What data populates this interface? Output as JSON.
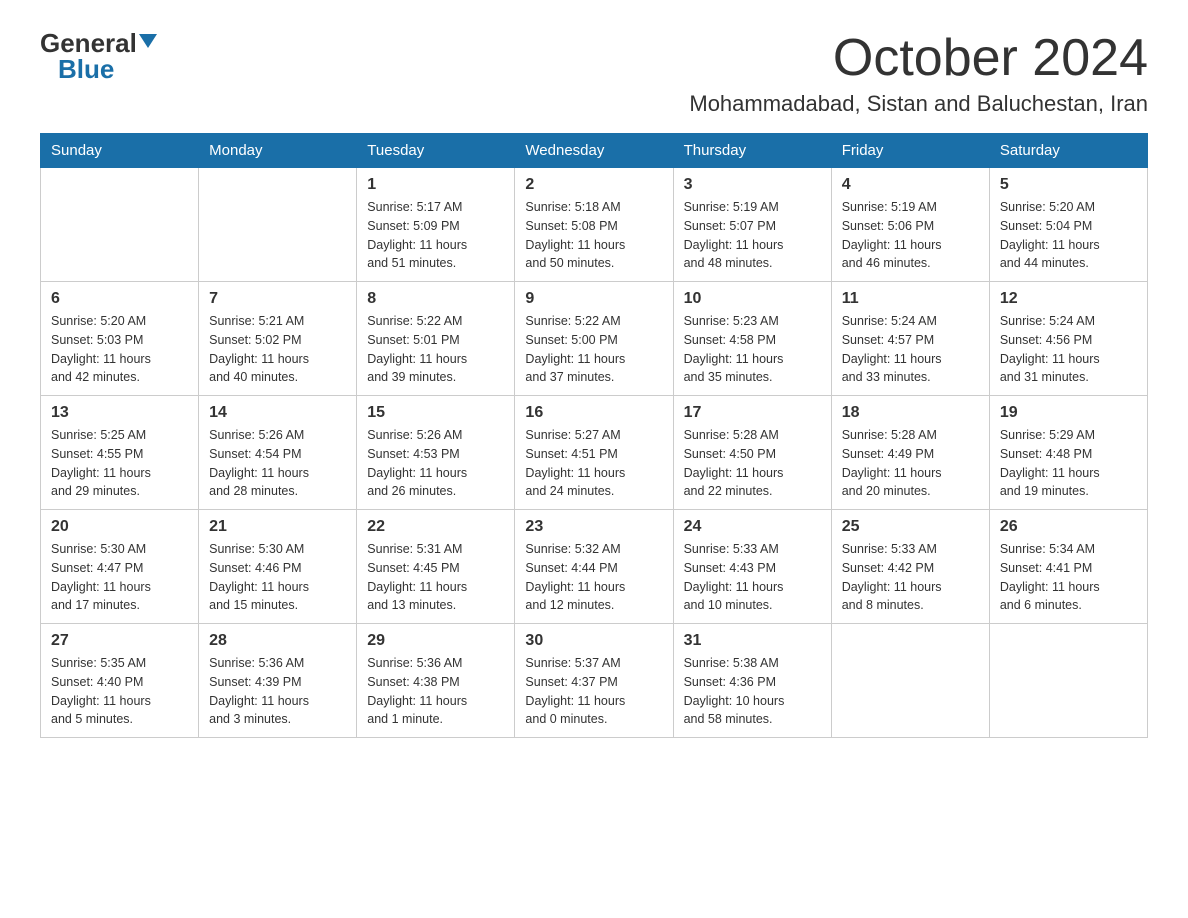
{
  "logo": {
    "general_text": "General",
    "blue_text": "Blue"
  },
  "title": "October 2024",
  "location": "Mohammadabad, Sistan and Baluchestan, Iran",
  "days_of_week": [
    "Sunday",
    "Monday",
    "Tuesday",
    "Wednesday",
    "Thursday",
    "Friday",
    "Saturday"
  ],
  "weeks": [
    [
      {
        "day": "",
        "info": ""
      },
      {
        "day": "",
        "info": ""
      },
      {
        "day": "1",
        "info": "Sunrise: 5:17 AM\nSunset: 5:09 PM\nDaylight: 11 hours\nand 51 minutes."
      },
      {
        "day": "2",
        "info": "Sunrise: 5:18 AM\nSunset: 5:08 PM\nDaylight: 11 hours\nand 50 minutes."
      },
      {
        "day": "3",
        "info": "Sunrise: 5:19 AM\nSunset: 5:07 PM\nDaylight: 11 hours\nand 48 minutes."
      },
      {
        "day": "4",
        "info": "Sunrise: 5:19 AM\nSunset: 5:06 PM\nDaylight: 11 hours\nand 46 minutes."
      },
      {
        "day": "5",
        "info": "Sunrise: 5:20 AM\nSunset: 5:04 PM\nDaylight: 11 hours\nand 44 minutes."
      }
    ],
    [
      {
        "day": "6",
        "info": "Sunrise: 5:20 AM\nSunset: 5:03 PM\nDaylight: 11 hours\nand 42 minutes."
      },
      {
        "day": "7",
        "info": "Sunrise: 5:21 AM\nSunset: 5:02 PM\nDaylight: 11 hours\nand 40 minutes."
      },
      {
        "day": "8",
        "info": "Sunrise: 5:22 AM\nSunset: 5:01 PM\nDaylight: 11 hours\nand 39 minutes."
      },
      {
        "day": "9",
        "info": "Sunrise: 5:22 AM\nSunset: 5:00 PM\nDaylight: 11 hours\nand 37 minutes."
      },
      {
        "day": "10",
        "info": "Sunrise: 5:23 AM\nSunset: 4:58 PM\nDaylight: 11 hours\nand 35 minutes."
      },
      {
        "day": "11",
        "info": "Sunrise: 5:24 AM\nSunset: 4:57 PM\nDaylight: 11 hours\nand 33 minutes."
      },
      {
        "day": "12",
        "info": "Sunrise: 5:24 AM\nSunset: 4:56 PM\nDaylight: 11 hours\nand 31 minutes."
      }
    ],
    [
      {
        "day": "13",
        "info": "Sunrise: 5:25 AM\nSunset: 4:55 PM\nDaylight: 11 hours\nand 29 minutes."
      },
      {
        "day": "14",
        "info": "Sunrise: 5:26 AM\nSunset: 4:54 PM\nDaylight: 11 hours\nand 28 minutes."
      },
      {
        "day": "15",
        "info": "Sunrise: 5:26 AM\nSunset: 4:53 PM\nDaylight: 11 hours\nand 26 minutes."
      },
      {
        "day": "16",
        "info": "Sunrise: 5:27 AM\nSunset: 4:51 PM\nDaylight: 11 hours\nand 24 minutes."
      },
      {
        "day": "17",
        "info": "Sunrise: 5:28 AM\nSunset: 4:50 PM\nDaylight: 11 hours\nand 22 minutes."
      },
      {
        "day": "18",
        "info": "Sunrise: 5:28 AM\nSunset: 4:49 PM\nDaylight: 11 hours\nand 20 minutes."
      },
      {
        "day": "19",
        "info": "Sunrise: 5:29 AM\nSunset: 4:48 PM\nDaylight: 11 hours\nand 19 minutes."
      }
    ],
    [
      {
        "day": "20",
        "info": "Sunrise: 5:30 AM\nSunset: 4:47 PM\nDaylight: 11 hours\nand 17 minutes."
      },
      {
        "day": "21",
        "info": "Sunrise: 5:30 AM\nSunset: 4:46 PM\nDaylight: 11 hours\nand 15 minutes."
      },
      {
        "day": "22",
        "info": "Sunrise: 5:31 AM\nSunset: 4:45 PM\nDaylight: 11 hours\nand 13 minutes."
      },
      {
        "day": "23",
        "info": "Sunrise: 5:32 AM\nSunset: 4:44 PM\nDaylight: 11 hours\nand 12 minutes."
      },
      {
        "day": "24",
        "info": "Sunrise: 5:33 AM\nSunset: 4:43 PM\nDaylight: 11 hours\nand 10 minutes."
      },
      {
        "day": "25",
        "info": "Sunrise: 5:33 AM\nSunset: 4:42 PM\nDaylight: 11 hours\nand 8 minutes."
      },
      {
        "day": "26",
        "info": "Sunrise: 5:34 AM\nSunset: 4:41 PM\nDaylight: 11 hours\nand 6 minutes."
      }
    ],
    [
      {
        "day": "27",
        "info": "Sunrise: 5:35 AM\nSunset: 4:40 PM\nDaylight: 11 hours\nand 5 minutes."
      },
      {
        "day": "28",
        "info": "Sunrise: 5:36 AM\nSunset: 4:39 PM\nDaylight: 11 hours\nand 3 minutes."
      },
      {
        "day": "29",
        "info": "Sunrise: 5:36 AM\nSunset: 4:38 PM\nDaylight: 11 hours\nand 1 minute."
      },
      {
        "day": "30",
        "info": "Sunrise: 5:37 AM\nSunset: 4:37 PM\nDaylight: 11 hours\nand 0 minutes."
      },
      {
        "day": "31",
        "info": "Sunrise: 5:38 AM\nSunset: 4:36 PM\nDaylight: 10 hours\nand 58 minutes."
      },
      {
        "day": "",
        "info": ""
      },
      {
        "day": "",
        "info": ""
      }
    ]
  ]
}
